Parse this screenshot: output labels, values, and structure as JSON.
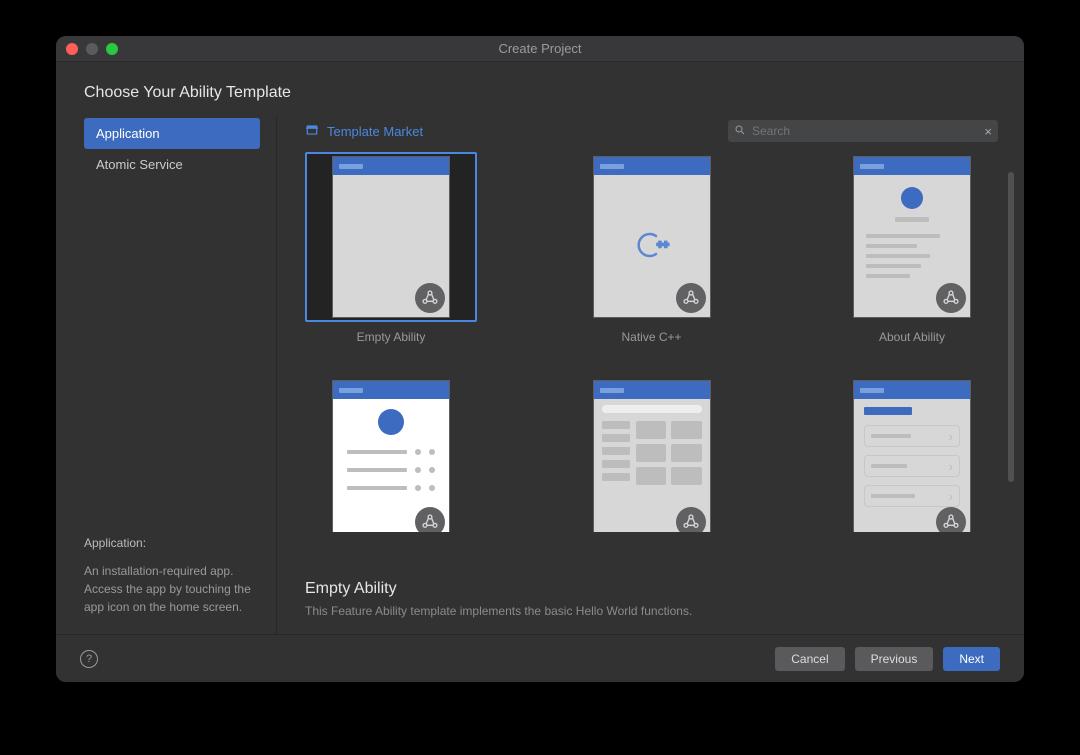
{
  "window": {
    "title": "Create Project"
  },
  "header": {
    "title": "Choose Your Ability Template"
  },
  "sidebar": {
    "categories": [
      {
        "label": "Application",
        "selected": true
      },
      {
        "label": "Atomic Service",
        "selected": false
      }
    ],
    "desc_title": "Application:",
    "desc_body": "An installation-required app. Access the app by touching the app icon on the home screen."
  },
  "toolbar": {
    "market_label": "Template Market",
    "search_placeholder": "Search"
  },
  "templates": [
    {
      "key": "empty",
      "label": "Empty Ability",
      "kind": "empty",
      "selected": true
    },
    {
      "key": "nativecpp",
      "label": "Native C++",
      "kind": "cpp",
      "selected": false
    },
    {
      "key": "about",
      "label": "About Ability",
      "kind": "about",
      "selected": false
    },
    {
      "key": "category",
      "label": "",
      "kind": "profile",
      "selected": false
    },
    {
      "key": "grid",
      "label": "",
      "kind": "grid",
      "selected": false
    },
    {
      "key": "list",
      "label": "",
      "kind": "listcard",
      "selected": false
    }
  ],
  "selected": {
    "title": "Empty Ability",
    "desc": "This Feature Ability template implements the basic Hello World functions."
  },
  "footer": {
    "cancel": "Cancel",
    "previous": "Previous",
    "next": "Next"
  }
}
